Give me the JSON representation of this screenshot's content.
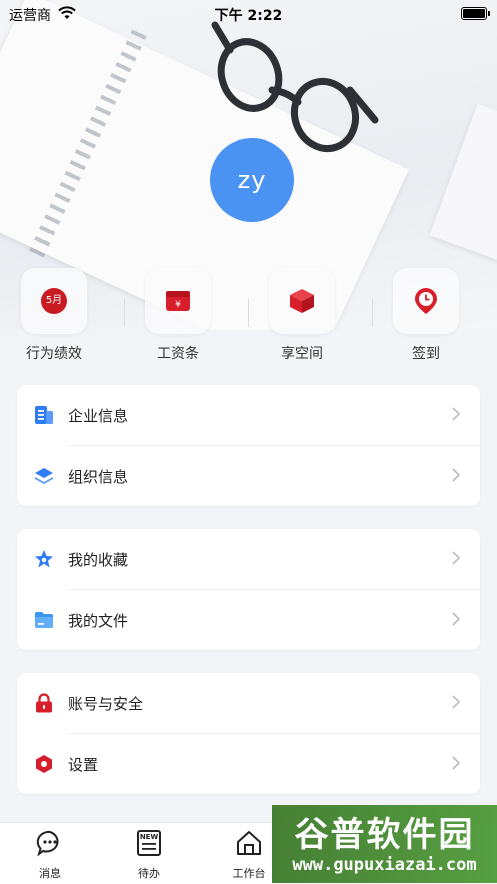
{
  "status": {
    "carrier": "运营商",
    "time": "下午 2:22"
  },
  "profile": {
    "avatar_text": "zy"
  },
  "quick_actions": [
    {
      "label": "行为绩效",
      "badge": "5月",
      "icon": "calendar-badge-icon"
    },
    {
      "label": "工资条",
      "icon": "salary-envelope-icon"
    },
    {
      "label": "享空间",
      "icon": "cube-icon"
    },
    {
      "label": "签到",
      "icon": "location-clock-icon"
    }
  ],
  "groups": [
    {
      "items": [
        {
          "label": "企业信息",
          "icon": "building-icon",
          "color": "#2f7cf6"
        },
        {
          "label": "组织信息",
          "icon": "layers-icon",
          "color": "#2f7cf6"
        }
      ]
    },
    {
      "items": [
        {
          "label": "我的收藏",
          "icon": "star-icon",
          "color": "#2f7cf6"
        },
        {
          "label": "我的文件",
          "icon": "folder-icon",
          "color": "#3d95f2"
        }
      ]
    },
    {
      "items": [
        {
          "label": "账号与安全",
          "icon": "lock-icon",
          "color": "#d81e2a"
        },
        {
          "label": "设置",
          "icon": "gear-hexagon-icon",
          "color": "#d81e2a"
        }
      ]
    }
  ],
  "tabbar": [
    {
      "label": "消息",
      "icon": "chat-bubble-icon"
    },
    {
      "label": "待办",
      "icon": "new-list-icon",
      "badge": "NEW"
    },
    {
      "label": "工作台",
      "icon": "home-icon"
    }
  ],
  "watermark": {
    "line1": "谷普软件园",
    "line2": "www.gupuxiazai.com"
  }
}
